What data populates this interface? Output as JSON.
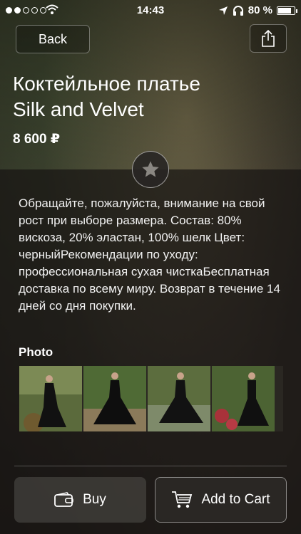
{
  "status_bar": {
    "time": "14:43",
    "battery": "80 %",
    "battery_level": 0.8,
    "signal_bars_filled": 2,
    "signal_bars_total": 5
  },
  "nav": {
    "back_label": "Back",
    "share_icon": "share-icon"
  },
  "product": {
    "title_line1": "Коктейльное платье",
    "title_line2": "Silk and Velvet",
    "price": "8 600 ₽",
    "description": "Обращайте, пожалуйста, внимание на свой рост при выборе размера. Состав: 80% вискоза, 20% эластан, 100% шелк Цвет: черныйРекомендации по уходу: профессиональная сухая чисткаБесплатная доставка по всему миру. Возврат в течение 14 дней со дня покупки."
  },
  "photos": {
    "heading": "Photo",
    "count_visible": 4
  },
  "actions": {
    "buy_label": "Buy",
    "add_to_cart_label": "Add to Cart"
  },
  "colors": {
    "accent": "#ffffff",
    "panel": "#161412"
  }
}
